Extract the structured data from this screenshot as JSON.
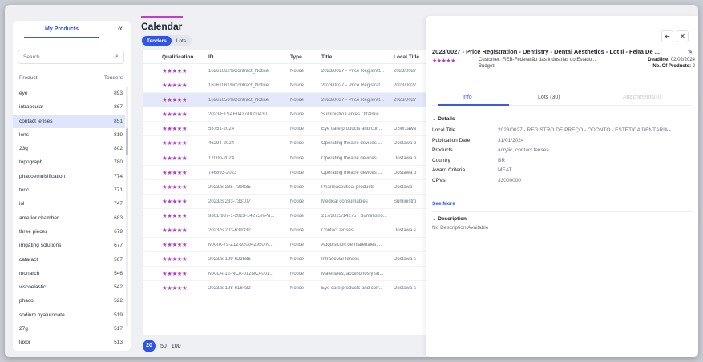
{
  "products_panel": {
    "title": "My Products",
    "collapse_icon": "double-chevron-left-icon",
    "search_placeholder": "Search...",
    "col_product": "Product",
    "col_tenders": "Tenders",
    "items": [
      {
        "name": "eye",
        "tenders": "893"
      },
      {
        "name": "intraocular",
        "tenders": "867"
      },
      {
        "name": "contact lenses",
        "tenders": "851"
      },
      {
        "name": "lens",
        "tenders": "819"
      },
      {
        "name": "23g",
        "tenders": "802"
      },
      {
        "name": "topograph",
        "tenders": "780"
      },
      {
        "name": "phacoemulsification",
        "tenders": "774"
      },
      {
        "name": "toric",
        "tenders": "771"
      },
      {
        "name": "iol",
        "tenders": "747"
      },
      {
        "name": "anterior chamber",
        "tenders": "683"
      },
      {
        "name": "three pieces",
        "tenders": "679"
      },
      {
        "name": "irrigating solutions",
        "tenders": "677"
      },
      {
        "name": "cataract",
        "tenders": "567"
      },
      {
        "name": "monarch",
        "tenders": "546"
      },
      {
        "name": "viscoelastic",
        "tenders": "542"
      },
      {
        "name": "phaco",
        "tenders": "522"
      },
      {
        "name": "sodium hyaluronate",
        "tenders": "519"
      },
      {
        "name": "27g",
        "tenders": "517"
      },
      {
        "name": "luxor",
        "tenders": "513"
      }
    ]
  },
  "main": {
    "title": "Calendar",
    "tabs": [
      "Tenders",
      "Lots"
    ],
    "columns": [
      "Qualification",
      "ID",
      "Type",
      "Title",
      "Local Title"
    ],
    "stars": "★★★★★",
    "rows": [
      {
        "id": "16261062%Contract_Notice",
        "type": "Notice",
        "title": "2023/0027 - Price Registrat...",
        "local": "2023/0027"
      },
      {
        "id": "16261061%Contract_Notice",
        "type": "Notice",
        "title": "2023/0027 - Price Registrat...",
        "local": "2023/0027"
      },
      {
        "id": "16261058%Contract_Notice",
        "type": "Notice",
        "title": "2023/0027 - Price Registrat...",
        "local": "2023/0027"
      },
      {
        "id": "2023/ETSAE0427/0000430...",
        "type": "Notice",
        "title": "Suministro Lentes Oftálmic...",
        "local": ""
      },
      {
        "id": "53751-2024",
        "type": "Notice",
        "title": "Eye care products and corr...",
        "local": "Dzierżawa"
      },
      {
        "id": "46294-2024",
        "type": "Notice",
        "title": "Operating theatre devices ...",
        "local": "Dostawa p"
      },
      {
        "id": "17000-2024",
        "type": "Notice",
        "title": "Operating theatre devices ...",
        "local": "Dostawa p"
      },
      {
        "id": "746893-2023",
        "type": "Notice",
        "title": "Operating theatre devices ...",
        "local": "Dostawa p"
      },
      {
        "id": "2023/S 235-739835",
        "type": "Notice",
        "title": "Pharmaceutical products",
        "local": "Dostawa l"
      },
      {
        "id": "2023/S 233-733107",
        "type": "Notice",
        "title": "Medical consumables",
        "local": "Suministro"
      },
      {
        "id": "9301-937-1-2023-14275%Pu...",
        "type": "Notice",
        "title": "217/2023/14275 : Suministro...",
        "local": ""
      },
      {
        "id": "2023/S 203-639332",
        "type": "Notice",
        "title": "Contact lenses",
        "local": "Dostawa s"
      },
      {
        "id": "MX-IA-79-Z12-920042950-N...",
        "type": "Notice",
        "title": "Adquisición de materiales, ...",
        "local": ""
      },
      {
        "id": "2023/S 199-623586",
        "type": "Notice",
        "title": "Intraocular lenses",
        "local": "Dostawa s"
      },
      {
        "id": "MX-LA-12-NCA-012NCA001...",
        "type": "Notice",
        "title": "Materiales, accesorios y su...",
        "local": ""
      },
      {
        "id": "2023/S 198-616432",
        "type": "Notice",
        "title": "Eye care products and corr...",
        "local": "Dostawa s"
      }
    ],
    "pager": [
      "20",
      "50",
      "100"
    ]
  },
  "detail": {
    "pin_icon": "pin-icon",
    "close_icon": "close-icon",
    "title": "2023/0027 - Price Registration - Dentistry - Dental Aesthetics - Lot Ii - Feira De ...",
    "edit_icon": "pencil-icon",
    "stars": "★★★★★",
    "customer": "Customer: FIEB-Federação das Indústrias do Estado ...",
    "budget": "Budget:",
    "deadline_label": "Deadline:",
    "deadline_value": "02/02/2024",
    "products_label": "No. Of Products:",
    "products_value": "2",
    "tabs": [
      "Info",
      "Lots (30)",
      "Attachments(0)"
    ],
    "details_header": "⌄ Details",
    "fields": [
      {
        "k": "Local Title",
        "v": "2023/0027 - REGISTRO DE PREÇO - ODONTO - ESTÉTICA DENTÁRIA -..."
      },
      {
        "k": "Publication Date",
        "v": "31/01/2024"
      },
      {
        "k": "Products",
        "v": "acrylic, contact lenses"
      },
      {
        "k": "Country",
        "v": "BR"
      },
      {
        "k": "Award Criteria",
        "v": "MEAT"
      },
      {
        "k": "CPVs",
        "v": "33000000"
      }
    ],
    "see_more": "See More",
    "description_header": "⌄ Description",
    "no_description": "No Description Available"
  }
}
